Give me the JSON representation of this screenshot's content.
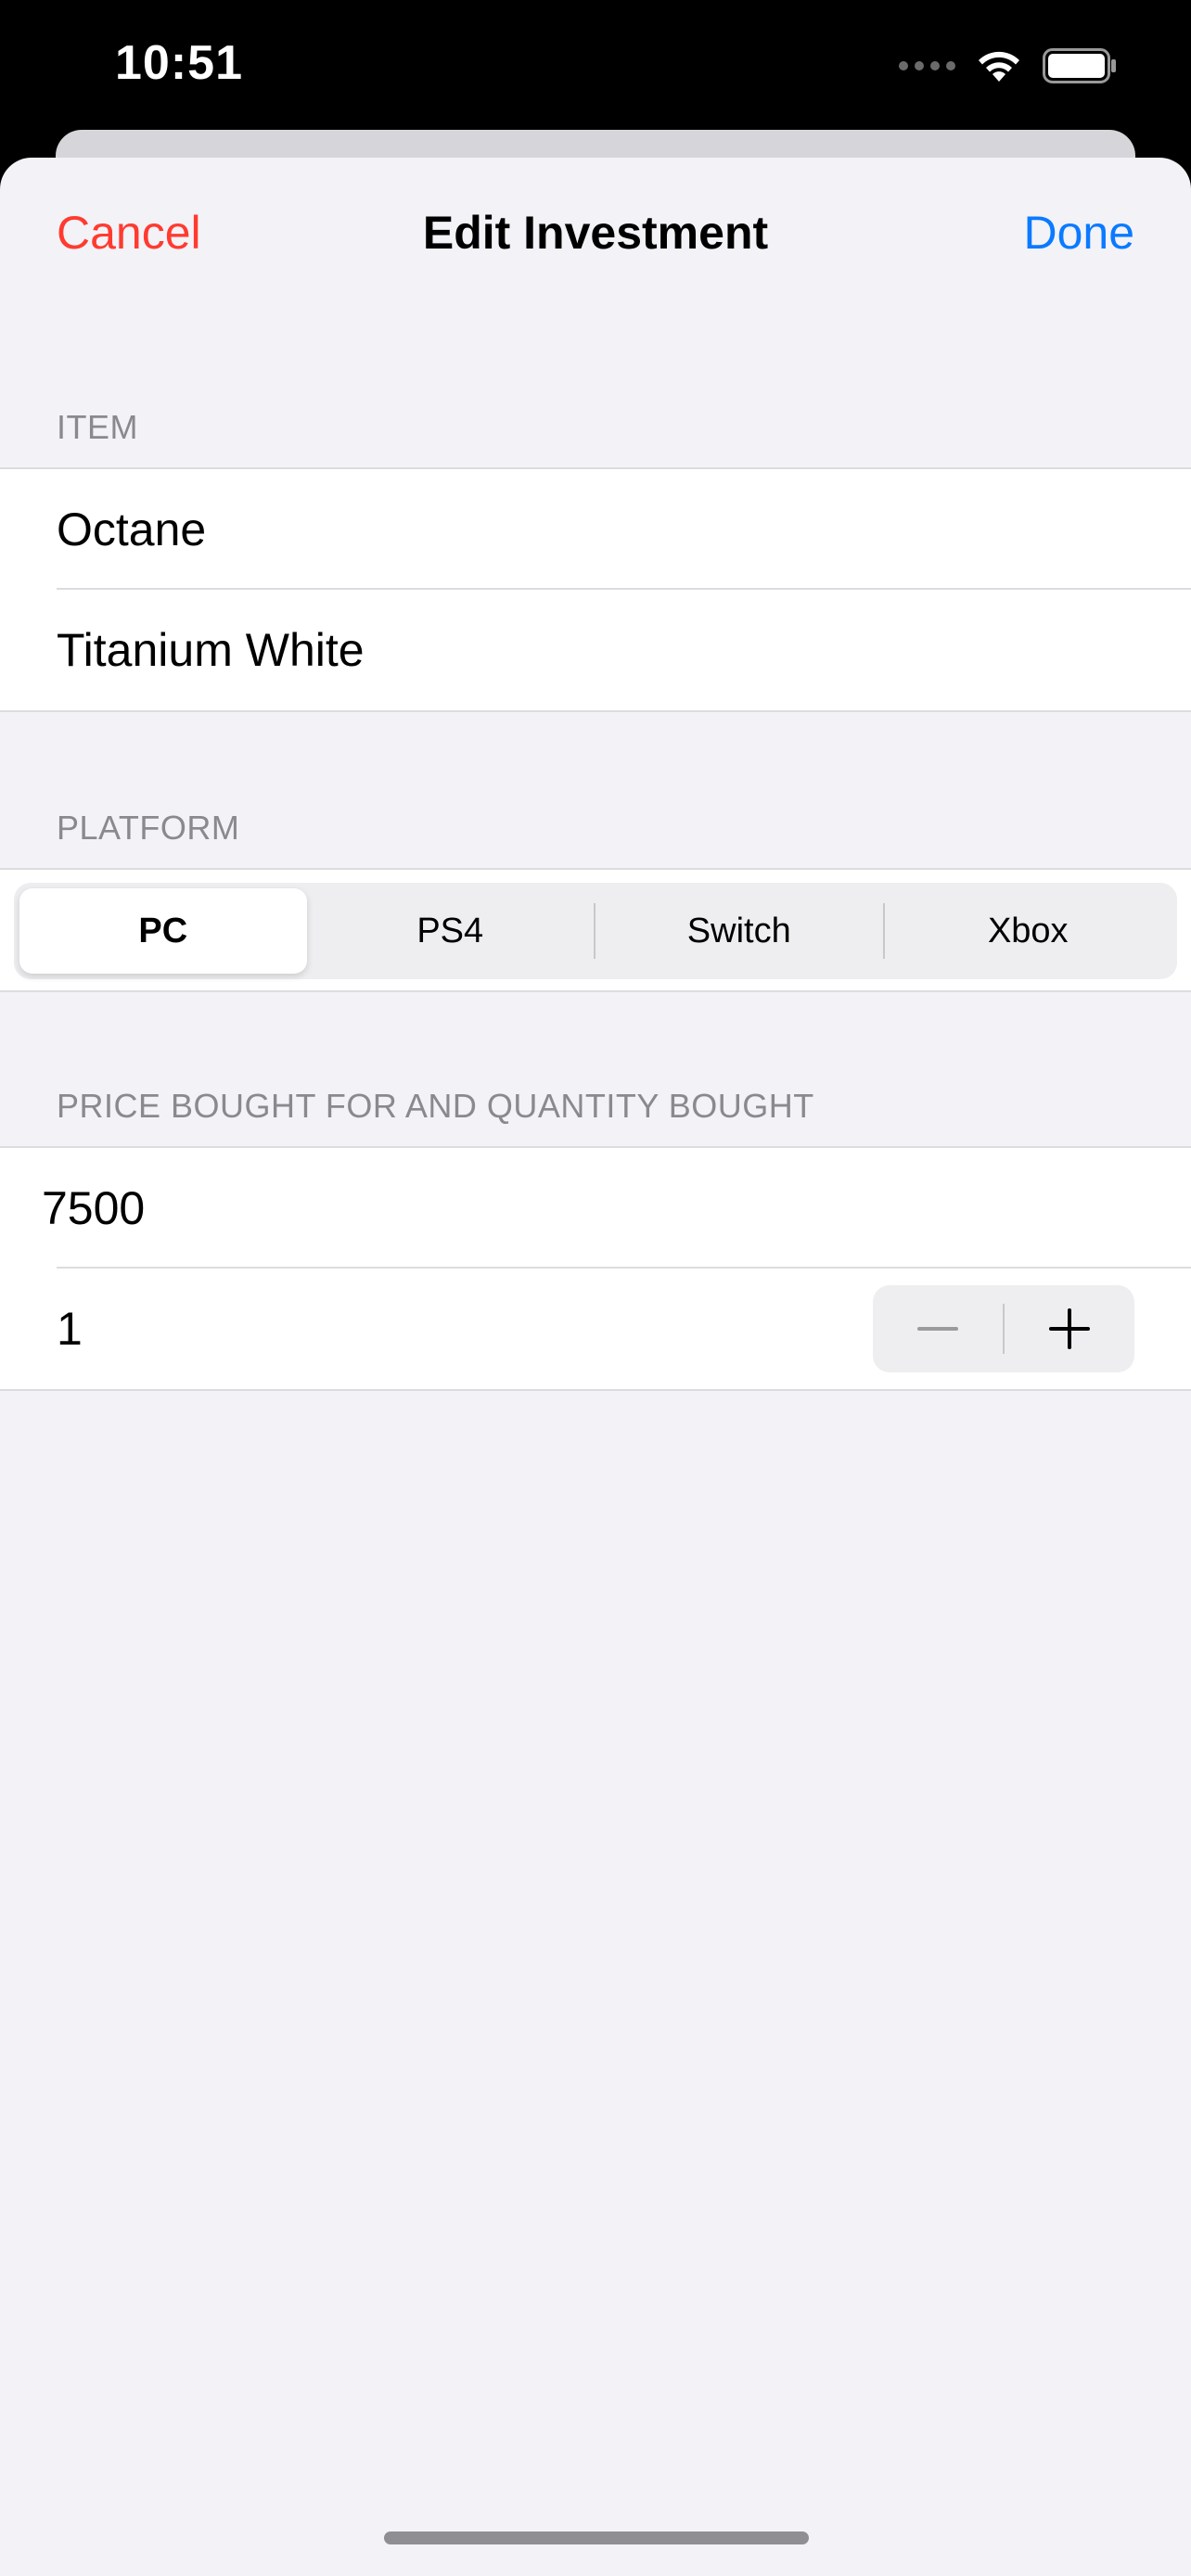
{
  "status_bar": {
    "time": "10:51",
    "icons": [
      "signal-dots-icon",
      "wifi-icon",
      "battery-icon"
    ]
  },
  "nav": {
    "cancel_label": "Cancel",
    "title": "Edit Investment",
    "done_label": "Done"
  },
  "sections": {
    "item": {
      "header": "ITEM",
      "rows": [
        "Octane",
        "Titanium White"
      ]
    },
    "platform": {
      "header": "PLATFORM",
      "segments": [
        "PC",
        "PS4",
        "Switch",
        "Xbox"
      ],
      "selected": "PC"
    },
    "price_qty": {
      "header": "PRICE BOUGHT FOR AND QUANTITY BOUGHT",
      "price": "7500",
      "quantity": "1",
      "stepper_icons": [
        "minus-icon",
        "plus-icon"
      ]
    }
  },
  "colors": {
    "cancel": "#ff3b30",
    "done": "#0a7aff",
    "background": "#f2f2f7",
    "header_text": "#8a8a8e"
  }
}
